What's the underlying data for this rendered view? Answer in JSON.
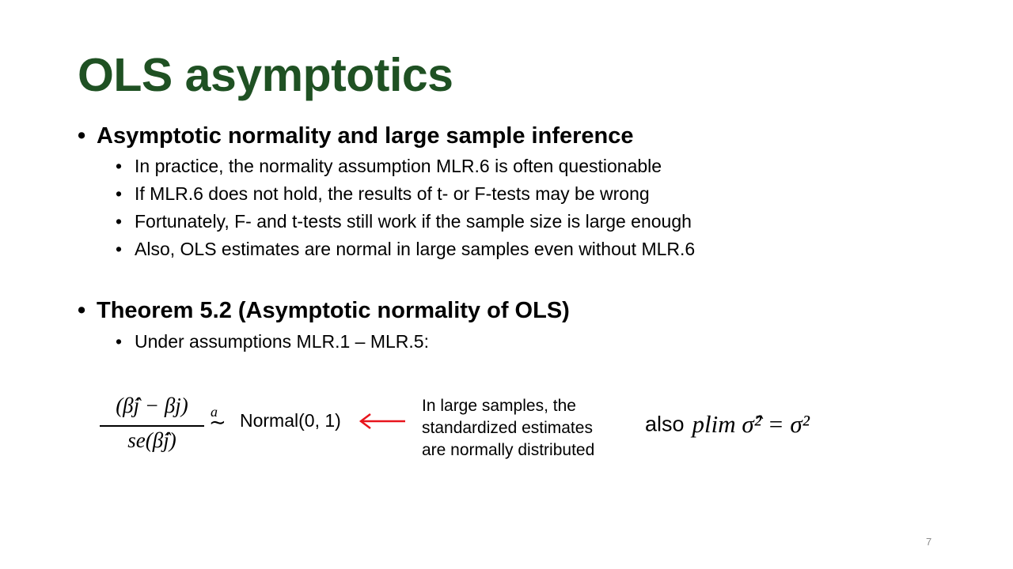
{
  "slide": {
    "title": "OLS asymptotics",
    "bullet_char": "•",
    "section1": {
      "heading": "Asymptotic normality and large sample inference",
      "items": [
        "In practice, the normality assumption MLR.6 is often questionable",
        "If MLR.6 does not hold, the results of t- or F-tests may be wrong",
        "Fortunately, F- and t-tests still work if the sample size is large enough",
        "Also, OLS estimates are normal in large samples even without MLR.6"
      ]
    },
    "section2": {
      "heading": "Theorem 5.2 (Asymptotic normality of OLS)",
      "items": [
        "Under assumptions MLR.1 – MLR.5:"
      ]
    },
    "formula": {
      "numerator": "(β̂j − βj)",
      "denominator": "se(β̂j)",
      "approx_letter": "a",
      "approx_symbol": "∼",
      "normal_label": "Normal(0, 1)"
    },
    "annotation": {
      "lines": [
        "In large samples, the",
        "standardized estimates",
        "are normally distributed"
      ],
      "arrow_color": "#e8141c"
    },
    "also": {
      "word": "also",
      "expression": "plim σ̂² = σ²"
    },
    "page_number": "7",
    "colors": {
      "title": "#1f5123",
      "text": "#000000",
      "arrow": "#e8141c",
      "page_number": "#8c8c8c"
    }
  }
}
